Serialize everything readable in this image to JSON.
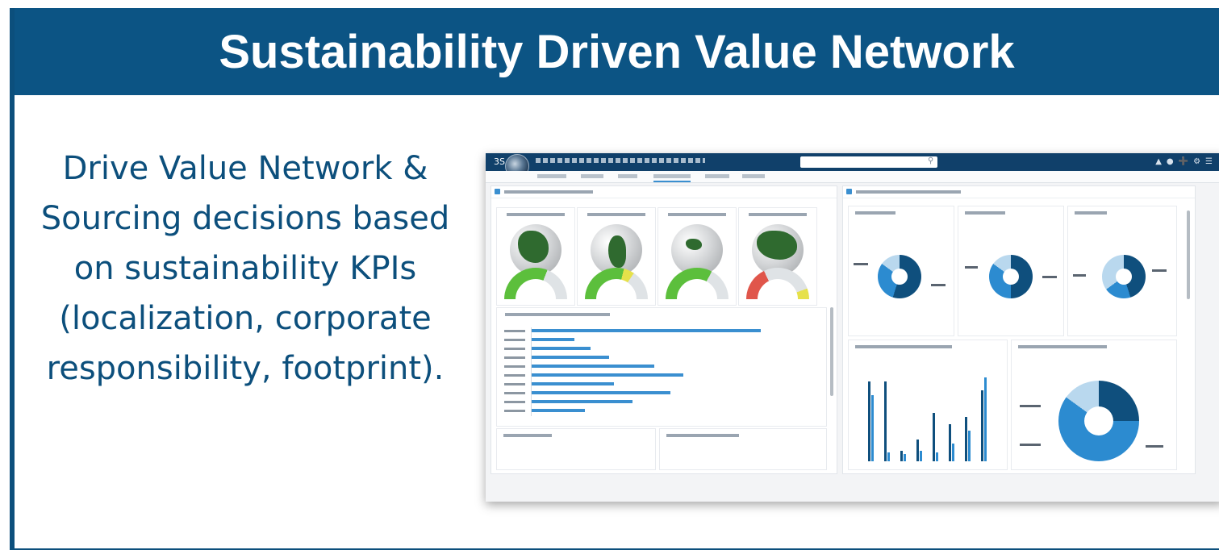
{
  "slide": {
    "title": "Sustainability Driven Value Network",
    "description": "Drive Value Network & Sourcing decisions based on sustainability KPIs (localization, corporate responsibility, footprint).",
    "description_lines": [
      "Drive Value Network &",
      "Sourcing decisions based",
      "on sustainability KPIs",
      "(localization, corporate",
      "responsibility, footprint)."
    ]
  },
  "screenshot": {
    "brand": "3S",
    "colors": {
      "title_bar": "#0c5484",
      "topbar": "#10406a",
      "bar_blue": "#3a8fd0",
      "land_green": "#2f6a2f",
      "gauge_green": "#5cbf3c",
      "gauge_red": "#e0564b",
      "donut_dark": "#0f4f7d",
      "donut_mid": "#2c8bd0",
      "donut_light": "#b9d8ee"
    },
    "icons": [
      "3ds-logo-icon",
      "compass-icon",
      "search-icon",
      "share-icon",
      "user-icon",
      "plus-icon",
      "settings-icon"
    ],
    "globe_regions": [
      "north-america",
      "south-america",
      "europe",
      "asia"
    ],
    "gauge_levels": [
      0.62,
      0.58,
      0.66,
      0.35
    ],
    "hbar_values": [
      0.86,
      0.16,
      0.22,
      0.29,
      0.46,
      0.57,
      0.31,
      0.52,
      0.38,
      0.2
    ],
    "vbar_groups": [
      [
        0.9,
        0.75
      ],
      [
        0.9,
        0.1
      ],
      [
        0.12,
        0.08
      ],
      [
        0.25,
        0.12
      ],
      [
        0.55,
        0.1
      ],
      [
        0.42,
        0.2
      ],
      [
        0.5,
        0.35
      ],
      [
        0.8,
        0.95
      ]
    ],
    "donuts": [
      {
        "dark": 0.55,
        "mid": 0.3,
        "light": 0.15
      },
      {
        "dark": 0.5,
        "mid": 0.35,
        "light": 0.15
      },
      {
        "dark": 0.45,
        "mid": 0.2,
        "light": 0.35
      },
      {
        "dark": 0.25,
        "mid": 0.6,
        "light": 0.15
      }
    ]
  }
}
